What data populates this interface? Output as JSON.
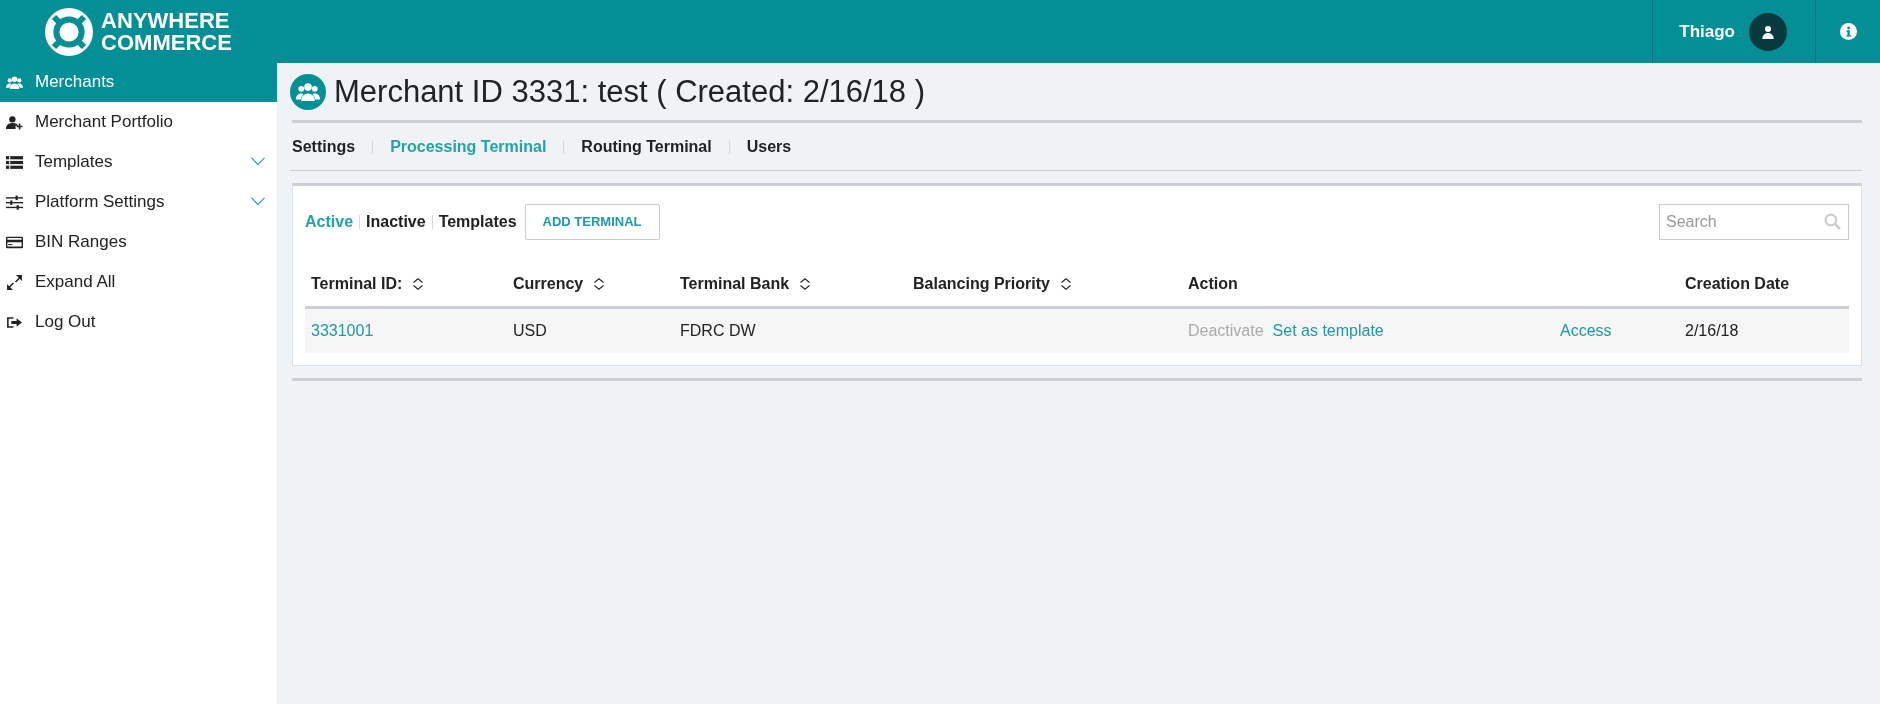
{
  "brand": {
    "line_1": "ANYWHERE",
    "line_2": "COMMERCE"
  },
  "user": {
    "name": "Thiago"
  },
  "sidebar": {
    "items": [
      {
        "label": "Merchants",
        "kind": "link",
        "selected": true
      },
      {
        "label": "Merchant Portfolio",
        "kind": "link",
        "selected": false
      },
      {
        "label": "Templates",
        "kind": "group",
        "selected": false
      },
      {
        "label": "Platform Settings",
        "kind": "group",
        "selected": false
      },
      {
        "label": "BIN Ranges",
        "kind": "link",
        "selected": false
      },
      {
        "label": "Expand All",
        "kind": "link",
        "selected": false
      },
      {
        "label": "Log Out",
        "kind": "link",
        "selected": false
      }
    ]
  },
  "page": {
    "title": "Merchant ID 3331: test ( Created: 2/16/18 )"
  },
  "tabs": [
    {
      "label": "Settings",
      "selected": false
    },
    {
      "label": "Processing Terminal",
      "selected": true
    },
    {
      "label": "Routing Terminal",
      "selected": false
    },
    {
      "label": "Users",
      "selected": false
    }
  ],
  "filters": [
    {
      "label": "Active",
      "selected": true
    },
    {
      "label": "Inactive",
      "selected": false
    },
    {
      "label": "Templates",
      "selected": false
    }
  ],
  "add_button": "ADD TERMINAL",
  "search": {
    "placeholder": "Search"
  },
  "table": {
    "columns": [
      {
        "label": "Terminal ID:",
        "sortable": true
      },
      {
        "label": "Currency",
        "sortable": true
      },
      {
        "label": "Terminal Bank",
        "sortable": true
      },
      {
        "label": "Balancing Priority",
        "sortable": true
      },
      {
        "label": "Action",
        "sortable": false
      },
      {
        "label": "Creation Date",
        "sortable": false
      }
    ],
    "rows": [
      {
        "terminal_id": "3331001",
        "currency": "USD",
        "terminal_bank": "FDRC DW",
        "actions": [
          {
            "label": "Deactivate",
            "disabled": true
          },
          {
            "label": "Set as template",
            "disabled": false
          }
        ],
        "access": "Access",
        "creation_date": "2/16/18"
      }
    ]
  }
}
